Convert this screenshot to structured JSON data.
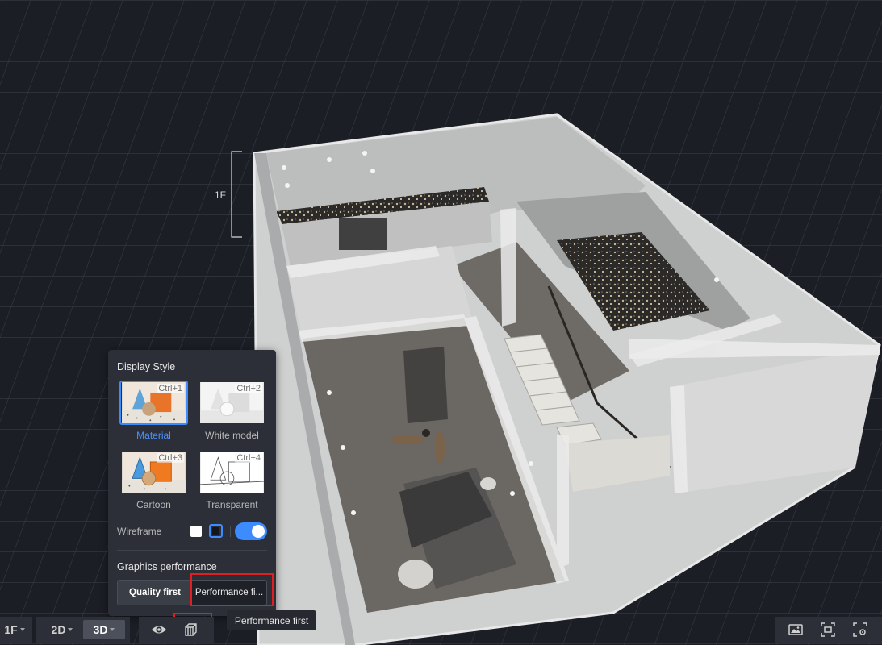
{
  "scene": {
    "level_label": "1F"
  },
  "display_panel": {
    "title": "Display Style",
    "styles": [
      {
        "label": "Material",
        "shortcut": "Ctrl+1",
        "selected": true
      },
      {
        "label": "White model",
        "shortcut": "Ctrl+2",
        "selected": false
      },
      {
        "label": "Cartoon",
        "shortcut": "Ctrl+3",
        "selected": false
      },
      {
        "label": "Transparent",
        "shortcut": "Ctrl+4",
        "selected": false
      }
    ],
    "wireframe_label": "Wireframe",
    "wireframe_enabled": true,
    "performance_title": "Graphics performance",
    "quality_label": "Quality first",
    "performance_label": "Performance fi..."
  },
  "tooltip": {
    "text": "Performance first"
  },
  "toolbar": {
    "floor_label": "1F",
    "view_2d_label": "2D",
    "view_3d_label": "3D",
    "active_view": "3D",
    "icons": [
      "eye-icon",
      "cube-icon",
      "image-icon",
      "screenshot-icon",
      "settings-icon"
    ]
  },
  "colors": {
    "accent": "#3c8cff",
    "highlight": "#e02020",
    "background": "#1a1d24"
  }
}
